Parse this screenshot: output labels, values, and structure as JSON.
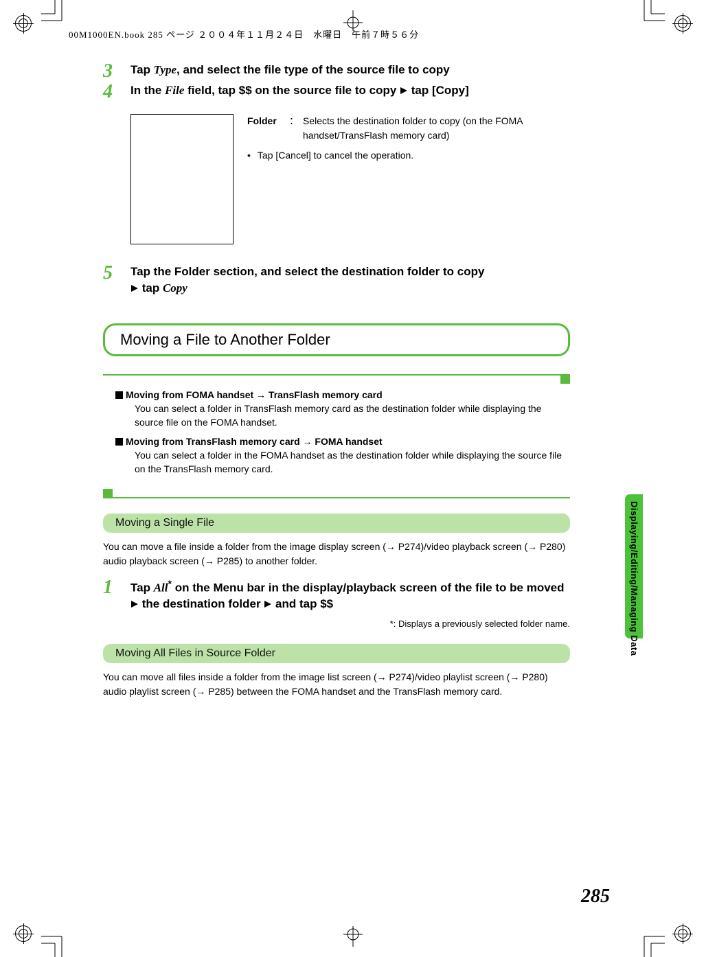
{
  "header": "00M1000EN.book  285 ページ  ２００４年１１月２４日　水曜日　午前７時５６分",
  "steps": {
    "s3": {
      "num": "3",
      "pre": "Tap ",
      "it": "Type",
      "post": ", and select the file type of the source file to copy"
    },
    "s4": {
      "num": "4",
      "pre": "In the ",
      "it": "File",
      "post1": " field, tap $$ on the source file to copy ",
      "post2": " tap [Copy]"
    },
    "s5": {
      "num": "5",
      "line1": "Tap the Folder section, and select the destination folder to copy",
      "line2_pre": " tap ",
      "line2_it": "Copy"
    },
    "s1b": {
      "num": "1",
      "pre": "Tap ",
      "it": "All",
      "sup": "*",
      "mid": " on the Menu bar in the display/playback screen of the file to be moved ",
      "mid2": " the destination folder ",
      "tail": " and tap $$"
    }
  },
  "info": {
    "label": "Folder",
    "desc": "Selects the destination folder to copy (on the FOMA handset/TransFlash memory card)",
    "bullet": "Tap [Cancel] to cancel the operation."
  },
  "section_title": "Moving a File to Another Folder",
  "notes": {
    "n1": {
      "head": "Moving from FOMA handset → TransFlash memory card",
      "body": "You can select a folder in TransFlash memory card as the destination folder while displaying the source file on the FOMA handset."
    },
    "n2": {
      "head": "Moving from TransFlash memory card → FOMA handset",
      "body": "You can select a folder in the FOMA handset as the destination folder while displaying the source file on the TransFlash memory card."
    }
  },
  "sub1": {
    "title": "Moving a Single File",
    "body": "You can move a file inside a folder from the image display screen (→ P274)/video playback screen (→ P280) audio playback screen (→ P285) to another folder.",
    "footnote": "*: Displays a previously selected folder name."
  },
  "sub2": {
    "title": "Moving All Files in Source Folder",
    "body": "You can move all files inside a folder from the image list screen (→ P274)/video playlist screen (→ P280) audio playlist screen (→ P285) between the FOMA handset and the TransFlash memory card."
  },
  "side_tab": "Displaying/Editing/Managing Data",
  "page_num": "285"
}
